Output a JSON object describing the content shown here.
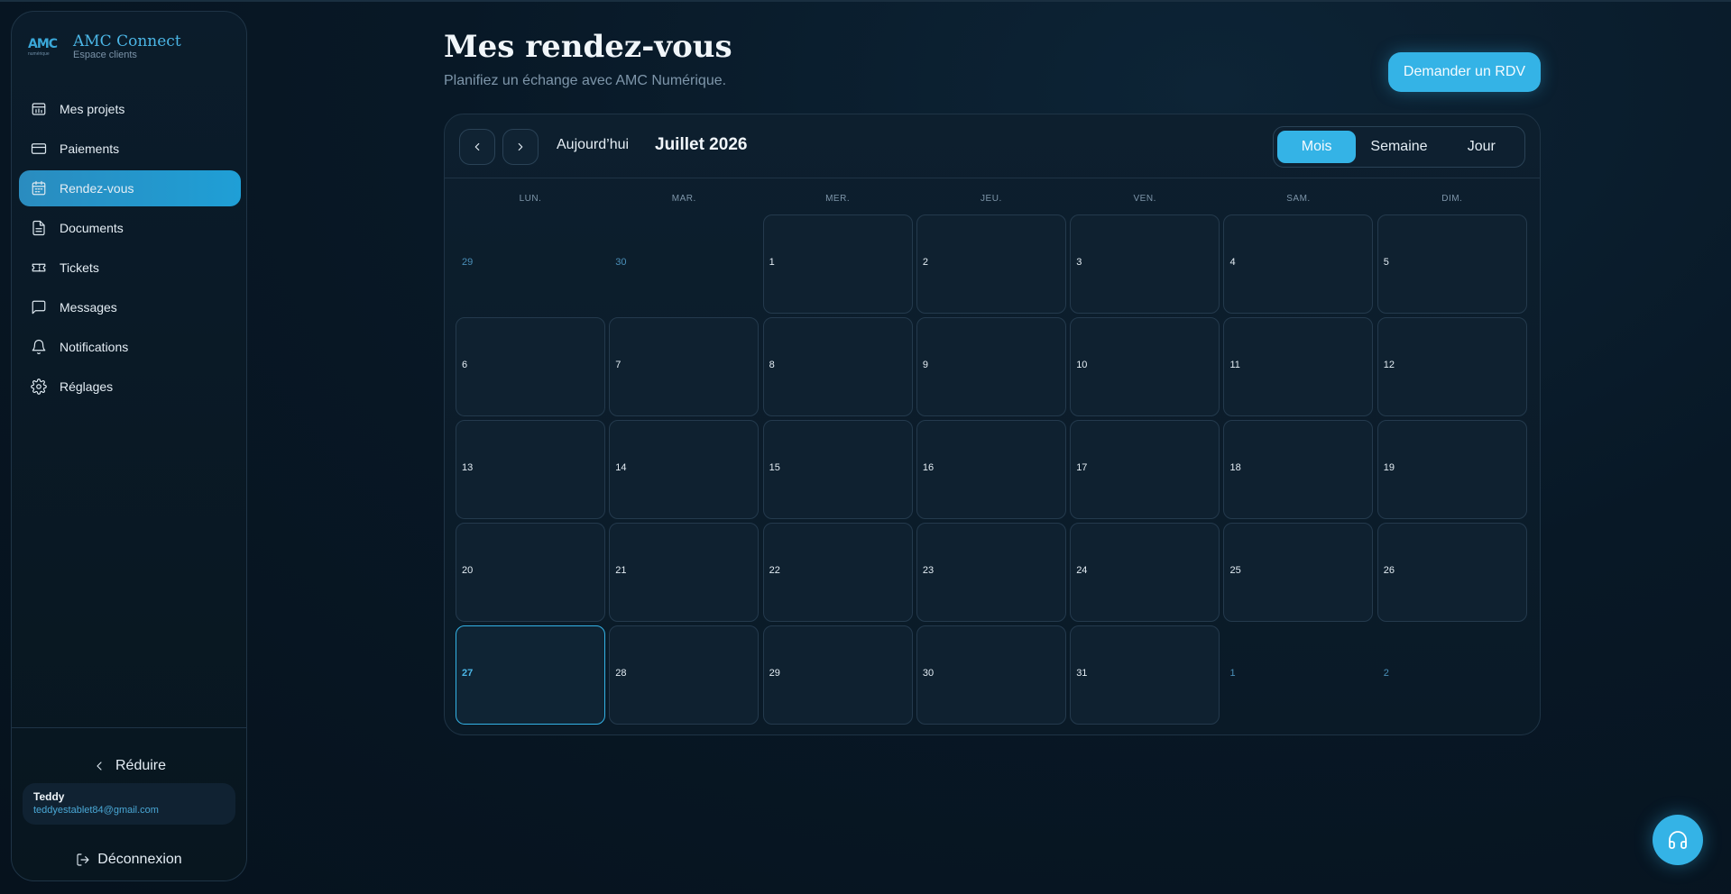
{
  "brand": {
    "logo_text": "AMC",
    "logo_sub": "numérique",
    "name": "AMC Connect",
    "subtitle": "Espace clients"
  },
  "sidebar": {
    "items": [
      {
        "label": "Mes projets",
        "icon": "projects-icon",
        "active": false
      },
      {
        "label": "Paiements",
        "icon": "credit-card-icon",
        "active": false
      },
      {
        "label": "Rendez-vous",
        "icon": "calendar-icon",
        "active": true
      },
      {
        "label": "Documents",
        "icon": "document-icon",
        "active": false
      },
      {
        "label": "Tickets",
        "icon": "ticket-icon",
        "active": false
      },
      {
        "label": "Messages",
        "icon": "message-icon",
        "active": false
      },
      {
        "label": "Notifications",
        "icon": "bell-icon",
        "active": false
      },
      {
        "label": "Réglages",
        "icon": "gear-icon",
        "active": false
      }
    ],
    "collapse_label": "Réduire",
    "user": {
      "name": "Teddy",
      "email": "teddyestablet84@gmail.com"
    },
    "logout_label": "Déconnexion"
  },
  "header": {
    "title": "Mes rendez-vous",
    "subtitle": "Planifiez un échange avec AMC Numérique.",
    "cta_label": "Demander un RDV"
  },
  "calendar": {
    "today_label": "Aujourd’hui",
    "month_label": "Juillet 2026",
    "views": [
      "Mois",
      "Semaine",
      "Jour"
    ],
    "active_view": "Mois",
    "weekdays": [
      "LUN.",
      "MAR.",
      "MER.",
      "JEU.",
      "VEN.",
      "SAM.",
      "DIM."
    ],
    "days": [
      {
        "n": "29",
        "outside": true
      },
      {
        "n": "30",
        "outside": true
      },
      {
        "n": "1"
      },
      {
        "n": "2"
      },
      {
        "n": "3"
      },
      {
        "n": "4"
      },
      {
        "n": "5"
      },
      {
        "n": "6"
      },
      {
        "n": "7"
      },
      {
        "n": "8"
      },
      {
        "n": "9"
      },
      {
        "n": "10"
      },
      {
        "n": "11"
      },
      {
        "n": "12"
      },
      {
        "n": "13"
      },
      {
        "n": "14"
      },
      {
        "n": "15"
      },
      {
        "n": "16"
      },
      {
        "n": "17"
      },
      {
        "n": "18"
      },
      {
        "n": "19"
      },
      {
        "n": "20"
      },
      {
        "n": "21"
      },
      {
        "n": "22"
      },
      {
        "n": "23"
      },
      {
        "n": "24"
      },
      {
        "n": "25"
      },
      {
        "n": "26"
      },
      {
        "n": "27",
        "today": true
      },
      {
        "n": "28"
      },
      {
        "n": "29"
      },
      {
        "n": "30"
      },
      {
        "n": "31"
      },
      {
        "n": "1",
        "outside": true
      },
      {
        "n": "2",
        "outside": true
      }
    ]
  },
  "colors": {
    "accent": "#34b3e6",
    "background": "#081826",
    "card": "#0f2130"
  },
  "support_icon": "headset-icon"
}
